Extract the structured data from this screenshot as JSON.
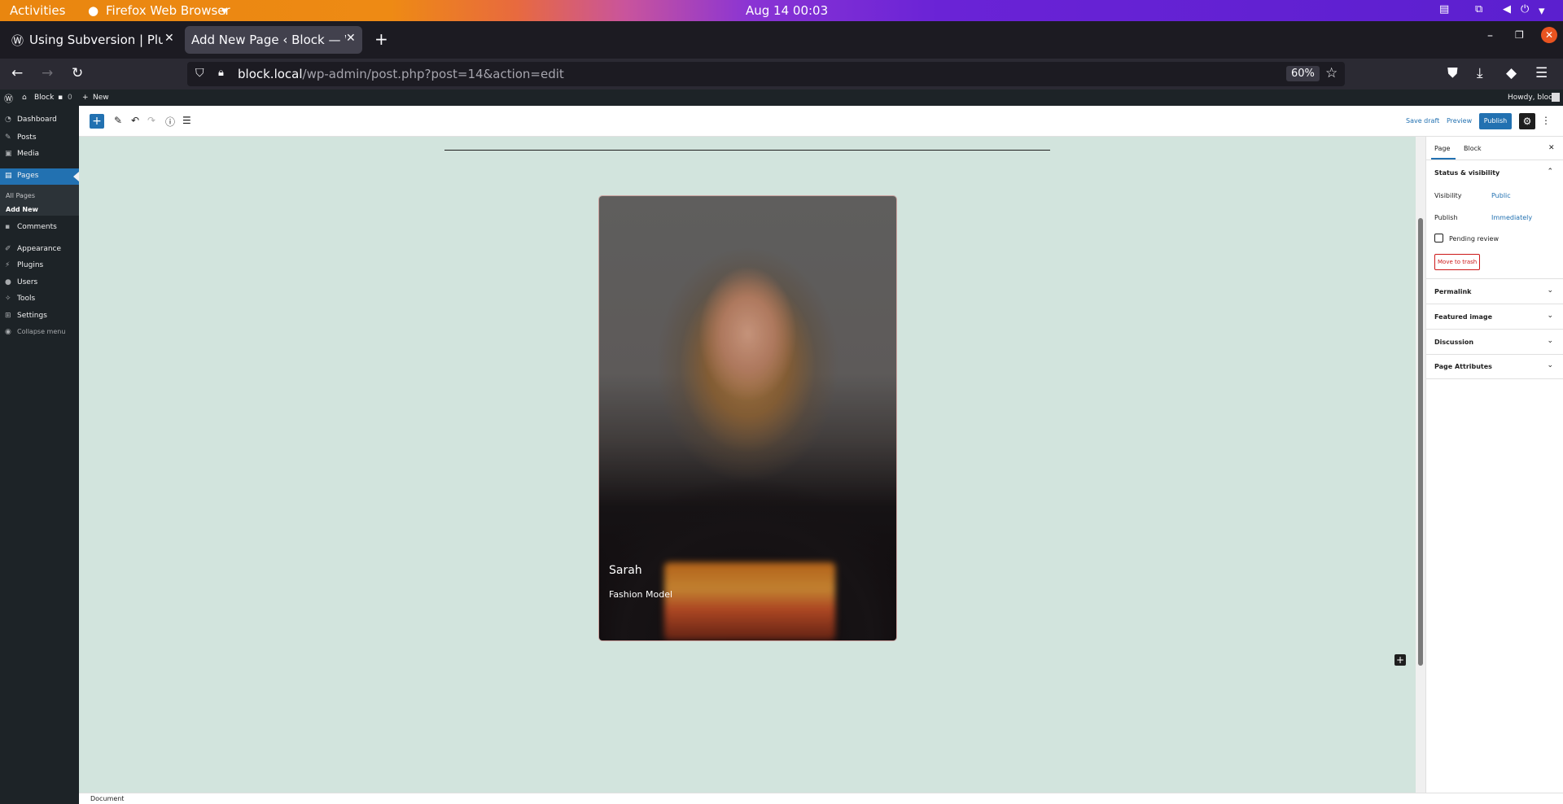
{
  "gnome": {
    "activities": "Activities",
    "app_name": "Firefox Web Browser",
    "clock": "Aug 14  00:03"
  },
  "browser": {
    "tabs": [
      {
        "title": "Using Subversion | Plugin",
        "active": false
      },
      {
        "title": "Add New Page ‹ Block — Wo",
        "active": true
      }
    ],
    "url_host": "block.local",
    "url_path": "/wp-admin/post.php?post=14&action=edit",
    "zoom": "60%"
  },
  "wp_admin_bar": {
    "site_name": "Block",
    "comments_count": "0",
    "new_label": "New",
    "howdy": "Howdy, block"
  },
  "sidebar": {
    "items": [
      {
        "label": "Dashboard",
        "icon": "dashboard-icon"
      },
      {
        "label": "Posts",
        "icon": "pin-icon"
      },
      {
        "label": "Media",
        "icon": "media-icon"
      },
      {
        "label": "Pages",
        "icon": "pages-icon"
      },
      {
        "label": "Comments",
        "icon": "comment-icon"
      },
      {
        "label": "Appearance",
        "icon": "brush-icon"
      },
      {
        "label": "Plugins",
        "icon": "plug-icon"
      },
      {
        "label": "Users",
        "icon": "user-icon"
      },
      {
        "label": "Tools",
        "icon": "wrench-icon"
      },
      {
        "label": "Settings",
        "icon": "settings-icon"
      },
      {
        "label": "Collapse menu",
        "icon": "collapse-icon"
      }
    ],
    "submenu": [
      "All Pages",
      "Add New"
    ]
  },
  "editor": {
    "save_draft": "Save draft",
    "preview": "Preview",
    "publish": "Publish",
    "cover": {
      "title": "Sarah",
      "subtitle": "Fashion Model"
    },
    "footer_breadcrumb": "Document"
  },
  "settings": {
    "tabs": [
      "Page",
      "Block"
    ],
    "status_visibility": "Status & visibility",
    "visibility_label": "Visibility",
    "visibility_value": "Public",
    "publish_label": "Publish",
    "publish_value": "Immediately",
    "pending_review": "Pending review",
    "move_to_trash": "Move to trash",
    "panels": [
      "Permalink",
      "Featured image",
      "Discussion",
      "Page Attributes"
    ]
  },
  "colors": {
    "wp_blue": "#2271b1",
    "canvas_bg": "#d2e4dd",
    "trash_red": "#cc1818"
  }
}
